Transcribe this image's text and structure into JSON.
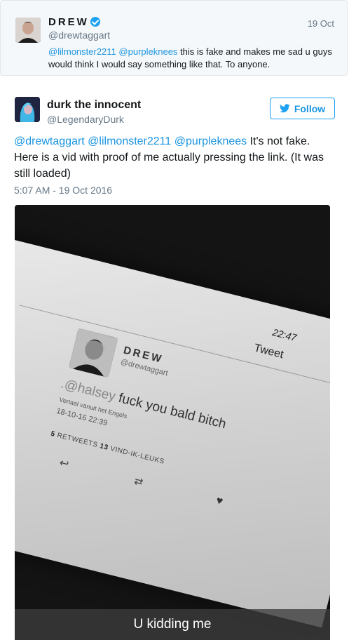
{
  "quoted_tweet": {
    "name": "DREW",
    "handle": "@drewtaggart",
    "date": "19 Oct",
    "mention1": "@lilmonster2211",
    "mention2": "@purpleknees",
    "text": "this is fake and makes me sad u guys would think I would say something like that. To anyone."
  },
  "tweet": {
    "name": "durk the innocent",
    "handle": "@LegendaryDurk",
    "follow_label": "Follow",
    "mentions": "@drewtaggart @lilmonster2211 @purpleknees",
    "text": "It's not fake. Here is a vid with proof of me actually pressing the link. (It was still loaded)",
    "timestamp": "5:07 AM - 19 Oct 2016"
  },
  "media": {
    "screen_time": "22:47",
    "screen_header": "Tweet",
    "screen_name": "DREW",
    "screen_handle": "@drewtaggart",
    "screen_mention": ".@halsey",
    "screen_text": "fuck you bald bitch",
    "screen_translate": "Vertaal vanuit het Engels",
    "screen_date": "18-10-16 22:39",
    "screen_retweets_count": "5",
    "screen_retweets_label": "RETWEETS",
    "screen_likes_count": "13",
    "screen_likes_label": "VIND-IK-LEUKS",
    "caption": "U kidding me"
  },
  "colors": {
    "link": "#1b95e0",
    "verified": "#1da1f2",
    "secondary_text": "#657786"
  }
}
